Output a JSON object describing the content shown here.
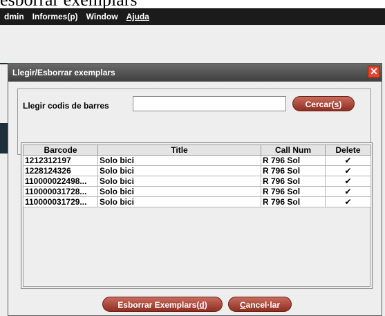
{
  "page_heading": "esborrar exemplars",
  "menubar": {
    "items": [
      "dmin",
      "Informes(p)",
      "Window",
      "Ajuda"
    ]
  },
  "dialog": {
    "title": "Llegir/Esborrar exemplars",
    "close_icon": "close-icon",
    "search_label": "Llegir codis de barres",
    "search_value": "",
    "search_button_label": "Cercar(",
    "search_button_mnemonic": "s",
    "table": {
      "columns": [
        "Barcode",
        "Title",
        "Call Num",
        "Delete"
      ],
      "rows": [
        {
          "barcode": "1212312197",
          "title": "Solo bici",
          "call_num": "R 796 Sol",
          "delete": "✔"
        },
        {
          "barcode": "1228124326",
          "title": "Solo bici",
          "call_num": "R 796 Sol",
          "delete": "✔"
        },
        {
          "barcode": "110000022498...",
          "title": "Solo bici",
          "call_num": "R 796 Sol",
          "delete": "✔"
        },
        {
          "barcode": "110000031728...",
          "title": "Solo bici",
          "call_num": "R 796 Sol",
          "delete": "✔"
        },
        {
          "barcode": "110000031729...",
          "title": "Solo bici",
          "call_num": "R 796 Sol",
          "delete": "✔"
        }
      ]
    },
    "delete_button_label": "Esborrar Exemplars(",
    "delete_button_mnemonic": "d",
    "cancel_button_mnemonic": "C",
    "cancel_button_label": "ancel·lar"
  }
}
